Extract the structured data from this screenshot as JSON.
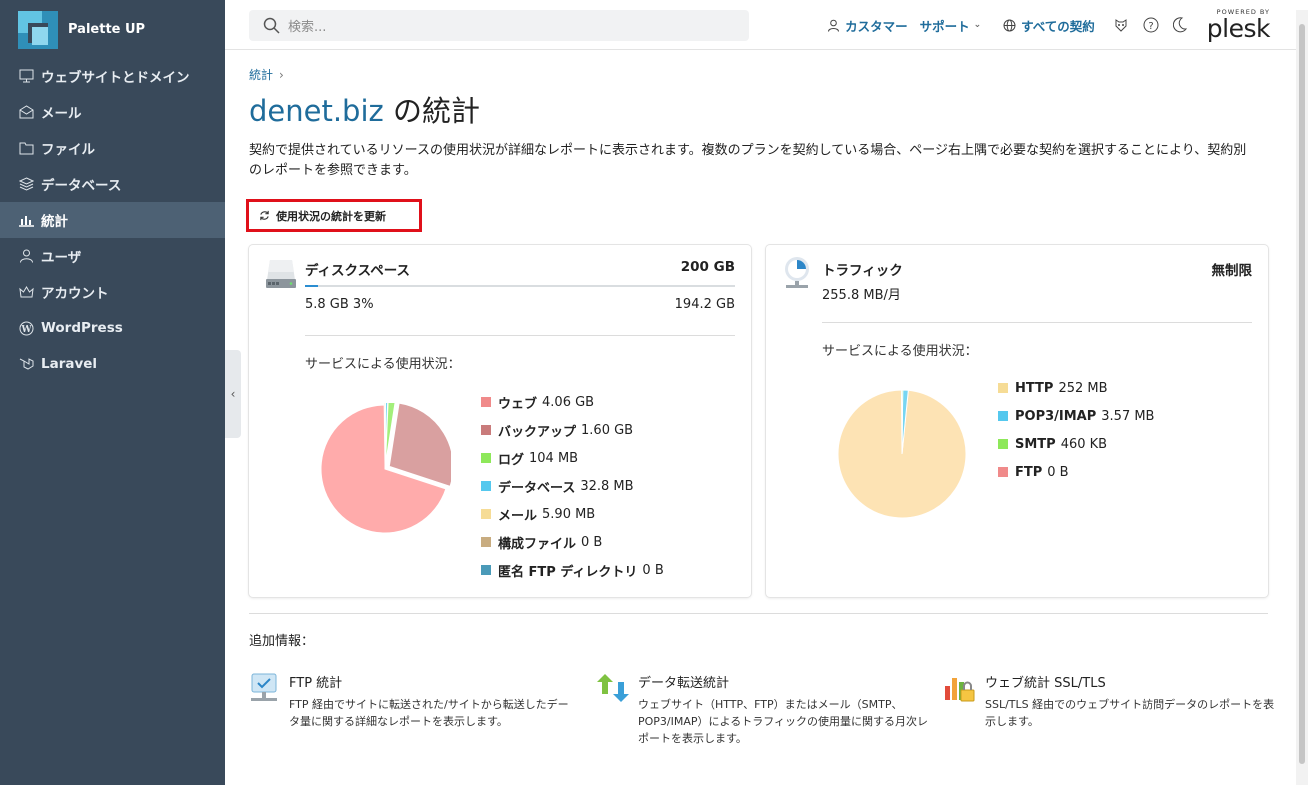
{
  "brand": {
    "name": "Palette UP"
  },
  "sidebar": {
    "items": [
      {
        "label": "ウェブサイトとドメイン",
        "icon": "monitor-icon"
      },
      {
        "label": "メール",
        "icon": "mail-icon"
      },
      {
        "label": "ファイル",
        "icon": "folder-icon"
      },
      {
        "label": "データベース",
        "icon": "database-icon"
      },
      {
        "label": "統計",
        "icon": "bar-chart-icon",
        "active": true
      },
      {
        "label": "ユーザ",
        "icon": "user-icon"
      },
      {
        "label": "アカウント",
        "icon": "crown-icon"
      },
      {
        "label": "WordPress",
        "icon": "wordpress-icon"
      },
      {
        "label": "Laravel",
        "icon": "laravel-icon"
      }
    ]
  },
  "topbar": {
    "search_placeholder": "検索...",
    "customer_label": "カスタマー",
    "support_label": "サポート",
    "subscriptions_label": "すべての契約",
    "powered_by": "POWERED BY",
    "plesk": "plesk"
  },
  "breadcrumb": {
    "item": "統計",
    "sep": "›"
  },
  "page": {
    "title_domain": "denet.biz",
    "title_suffix": "の統計",
    "description": "契約で提供されているリソースの使用状況が詳細なレポートに表示されます。複数のプランを契約している場合、ページ右上隅で必要な契約を選択することにより、契約別のレポートを参照できます。",
    "refresh_label": "使用状況の統計を更新"
  },
  "disk": {
    "title": "ディスクスペース",
    "total": "200 GB",
    "used": "5.8 GB 3%",
    "free": "194.2 GB",
    "used_fraction": 0.03,
    "pie_title": "サービスによる使用状況：",
    "legend": [
      {
        "name": "ウェブ",
        "value": "4.06 GB",
        "color": "#f08a8a"
      },
      {
        "name": "バックアップ",
        "value": "1.60 GB",
        "color": "#c97b7b"
      },
      {
        "name": "ログ",
        "value": "104 MB",
        "color": "#8ee85a"
      },
      {
        "name": "データベース",
        "value": "32.8 MB",
        "color": "#55c8ee"
      },
      {
        "name": "メール",
        "value": "5.90 MB",
        "color": "#f6dc96"
      },
      {
        "name": "構成ファイル",
        "value": "0 B",
        "color": "#c8ac80"
      },
      {
        "name": "匿名 FTP ディレクトリ",
        "value": "0 B",
        "color": "#4a9ab8"
      }
    ]
  },
  "traffic": {
    "title": "トラフィック",
    "limit": "無制限",
    "usage": "255.8 MB/月",
    "pie_title": "サービスによる使用状況：",
    "legend": [
      {
        "name": "HTTP",
        "value": "252 MB",
        "color": "#f6dc96"
      },
      {
        "name": "POP3/IMAP",
        "value": "3.57 MB",
        "color": "#55c8ee"
      },
      {
        "name": "SMTP",
        "value": "460 KB",
        "color": "#8ee85a"
      },
      {
        "name": "FTP",
        "value": "0 B",
        "color": "#f08a8a"
      }
    ]
  },
  "chart_data": [
    {
      "type": "pie",
      "categories": [
        "ウェブ",
        "バックアップ",
        "ログ",
        "データベース",
        "メール",
        "構成ファイル",
        "匿名 FTP ディレクトリ"
      ],
      "values": [
        4.06,
        1.6,
        0.104,
        0.0328,
        0.0059,
        0,
        0
      ],
      "unit": "GB",
      "colors": [
        "#ffabab",
        "#d9a0a0",
        "#a3ef7b",
        "#77d6f2",
        "#f9e5ad",
        "#d6bd94",
        "#6bb0c8"
      ]
    },
    {
      "type": "pie",
      "categories": [
        "HTTP",
        "POP3/IMAP",
        "SMTP",
        "FTP"
      ],
      "values": [
        252,
        3.57,
        0.46,
        0
      ],
      "unit": "MB",
      "colors": [
        "#fde3b4",
        "#77d6f2",
        "#a3ef7b",
        "#f2a0a0"
      ]
    }
  ],
  "additional": {
    "title": "追加情報：",
    "items": [
      {
        "title": "FTP 統計",
        "desc": "FTP 経由でサイトに転送された/サイトから転送したデータ量に関する詳細なレポートを表示します。"
      },
      {
        "title": "データ転送統計",
        "desc": "ウェブサイト（HTTP、FTP）またはメール（SMTP、POP3/IMAP）によるトラフィックの使用量に関する月次レポートを表示します。"
      },
      {
        "title": "ウェブ統計 SSL/TLS",
        "desc": "SSL/TLS 経由でのウェブサイト訪問データのレポートを表示します。"
      }
    ]
  }
}
